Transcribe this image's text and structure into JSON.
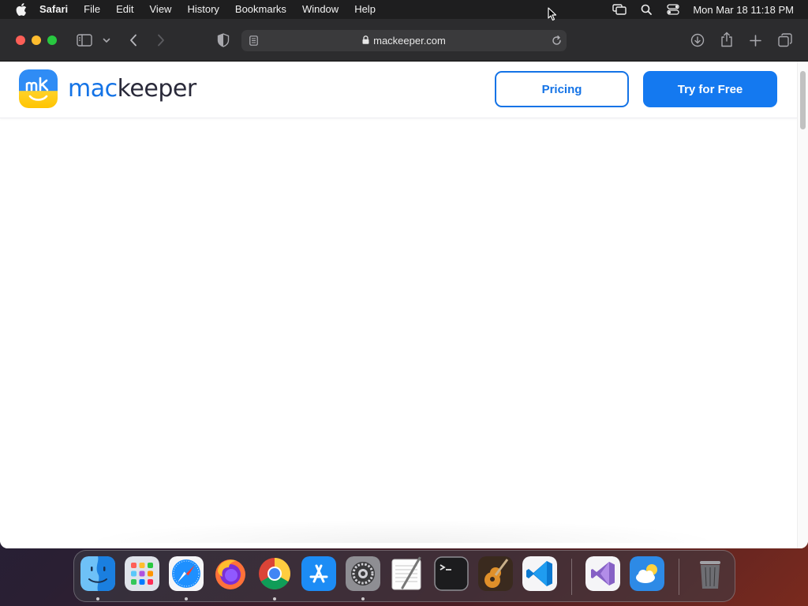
{
  "menubar": {
    "app_name": "Safari",
    "items": [
      "File",
      "Edit",
      "View",
      "History",
      "Bookmarks",
      "Window",
      "Help"
    ],
    "clock": "Mon Mar 18  11:18 PM",
    "status_icons": [
      "screen-mirroring-icon",
      "spotlight-search-icon",
      "control-center-icon"
    ]
  },
  "browser": {
    "url": "mackeeper.com",
    "secure": true,
    "toolbar_icons": [
      "sidebar-toggle-icon",
      "back-icon",
      "forward-icon",
      "privacy-shield-icon",
      "reader-icon",
      "reload-icon",
      "downloads-icon",
      "share-icon",
      "new-tab-icon",
      "tab-overview-icon"
    ]
  },
  "site": {
    "logo_word_1": "mac",
    "logo_word_2": "keeper",
    "pricing_label": "Pricing",
    "try_label": "Try for Free",
    "brand_color": "#1473e6"
  },
  "dock": {
    "apps": [
      "Finder",
      "Launchpad",
      "Safari",
      "Firefox",
      "Google Chrome",
      "App Store",
      "System Settings",
      "TextEdit",
      "Terminal",
      "GarageBand",
      "Visual Studio Code",
      "Visual Studio",
      "Weather",
      "Trash"
    ]
  }
}
